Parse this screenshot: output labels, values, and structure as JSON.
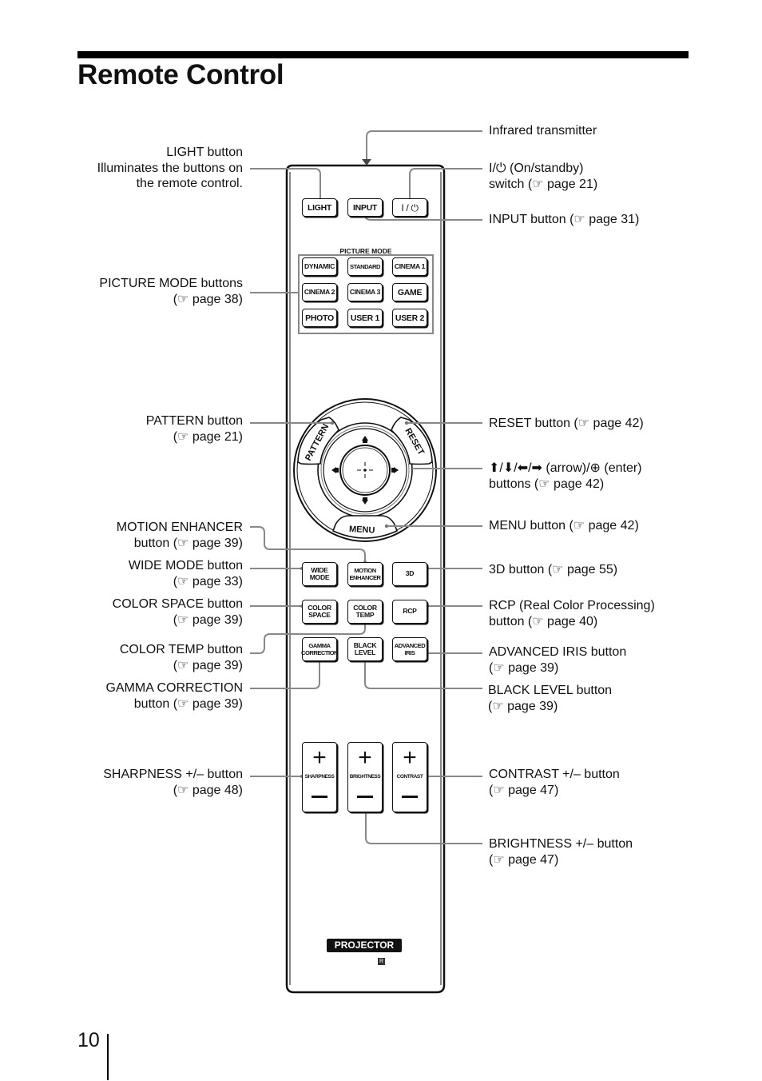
{
  "page": {
    "title": "Remote Control",
    "page_number": "10"
  },
  "remote": {
    "top_buttons": [
      "LIGHT",
      "INPUT",
      "I / ⏻"
    ],
    "picture_mode_title": "PICTURE MODE",
    "picture_mode_buttons": [
      "DYNAMIC",
      "STANDARD",
      "CINEMA 1",
      "CINEMA 2",
      "CINEMA 3",
      "GAME",
      "PHOTO",
      "USER 1",
      "USER 2"
    ],
    "ring": {
      "pattern": "PATTERN",
      "reset": "RESET",
      "menu": "MENU",
      "arrows": [
        "up-arrow",
        "down-arrow",
        "left-arrow",
        "right-arrow"
      ],
      "enter": "enter"
    },
    "function_buttons": [
      {
        "line1": "WIDE",
        "line2": "MODE"
      },
      {
        "line1": "MOTION",
        "line2": "ENHANCER"
      },
      {
        "line1": "3D",
        "line2": ""
      },
      {
        "line1": "COLOR",
        "line2": "SPACE"
      },
      {
        "line1": "COLOR",
        "line2": "TEMP"
      },
      {
        "line1": "RCP",
        "line2": ""
      },
      {
        "line1": "GAMMA",
        "line2": "CORRECTION"
      },
      {
        "line1": "BLACK",
        "line2": "LEVEL"
      },
      {
        "line1": "ADVANCED",
        "line2": "IRIS"
      }
    ],
    "volume_buttons": [
      {
        "label": "SHARPNESS",
        "plus": "+"
      },
      {
        "label": "BRIGHTNESS",
        "plus": "+"
      },
      {
        "label": "CONTRAST",
        "plus": "+"
      }
    ],
    "brand_label": "PROJECTOR",
    "brand_mark": "R"
  },
  "callouts_left": {
    "light": [
      "LIGHT button",
      "Illuminates the buttons on",
      "the remote control."
    ],
    "picture_mode": [
      "PICTURE MODE buttons",
      "(☞ page 38)"
    ],
    "pattern": [
      "PATTERN button",
      "(☞ page 21)"
    ],
    "motion_enhancer": [
      "MOTION ENHANCER",
      "button (☞ page 39)"
    ],
    "wide_mode": [
      "WIDE MODE button",
      "(☞ page 33)"
    ],
    "color_space": [
      "COLOR SPACE button",
      "(☞ page 39)"
    ],
    "color_temp": [
      "COLOR TEMP button",
      "(☞ page 39)"
    ],
    "gamma_correction": [
      "GAMMA CORRECTION",
      "button (☞ page 39)"
    ],
    "sharpness": [
      "SHARPNESS +/– button",
      "(☞ page 48)"
    ]
  },
  "callouts_right": {
    "infrared": [
      "Infrared transmitter"
    ],
    "on_standby": [
      "I/⏻ (On/standby)",
      "switch (☞ page 21)"
    ],
    "input": [
      "INPUT button (☞ page 31)"
    ],
    "reset": [
      "RESET button (☞ page 42)"
    ],
    "arrows": [
      "⬆/⬇/⬅/➡ (arrow)/⊕ (enter)",
      "buttons (☞ page 42)"
    ],
    "menu": [
      "MENU button (☞ page 42)"
    ],
    "three_d": [
      "3D button (☞ page 55)"
    ],
    "rcp": [
      "RCP (Real Color Processing)",
      "button (☞ page 40)"
    ],
    "advanced_iris": [
      "ADVANCED IRIS button",
      "(☞ page 39)"
    ],
    "black_level": [
      "BLACK LEVEL button",
      "(☞ page 39)"
    ],
    "contrast": [
      "CONTRAST +/– button",
      "(☞ page 47)"
    ],
    "brightness": [
      "BRIGHTNESS +/– button",
      "(☞ page 47)"
    ]
  }
}
